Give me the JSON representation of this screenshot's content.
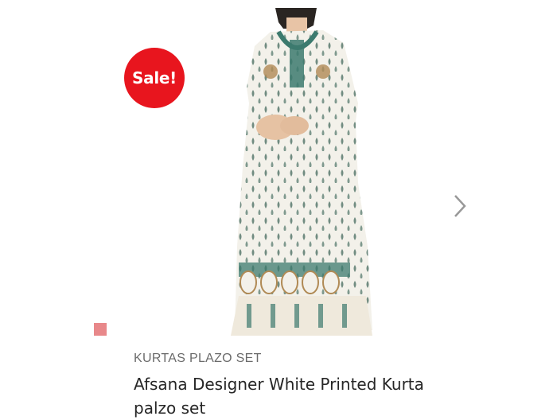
{
  "product": {
    "badge": "Sale!",
    "category": "KURTAS PLAZO SET",
    "title": "Afsana Designer White Printed Kurta palzo set",
    "image_alt": "Afsana Designer White Printed Kurta palzo set",
    "swatch_color": "#e8888a"
  },
  "colors": {
    "badge_bg": "#e8151e",
    "fabric": "#f3f1ea",
    "print": "#3c7a6e",
    "motif": "#b08a55"
  },
  "icons": {
    "next": "chevron-right-icon"
  }
}
